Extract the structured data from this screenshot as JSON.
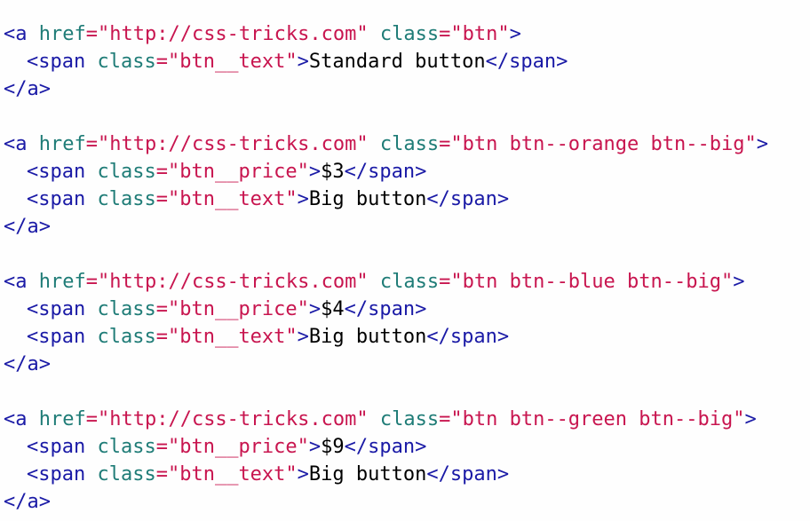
{
  "editor": {
    "blocks": [
      {
        "open_tag_start": "<a",
        "href_attr": "href",
        "href_eq": "=",
        "href_value": "\"http://css-tricks.com\"",
        "class_attr": "class",
        "class_eq": "=",
        "class_value": "\"btn\"",
        "open_tag_end": ">",
        "lines": [
          {
            "span_open": "<span",
            "class_attr": "class",
            "class_eq": "=",
            "class_value": "\"btn__text\"",
            "span_open_end": ">",
            "text": "Standard button",
            "span_close": "</span>"
          }
        ],
        "close_tag": "</a>"
      },
      {
        "open_tag_start": "<a",
        "href_attr": "href",
        "href_eq": "=",
        "href_value": "\"http://css-tricks.com\"",
        "class_attr": "class",
        "class_eq": "=",
        "class_value": "\"btn btn--orange btn--big\"",
        "open_tag_end": ">",
        "lines": [
          {
            "span_open": "<span",
            "class_attr": "class",
            "class_eq": "=",
            "class_value": "\"btn__price\"",
            "span_open_end": ">",
            "text": "$3",
            "span_close": "</span>"
          },
          {
            "span_open": "<span",
            "class_attr": "class",
            "class_eq": "=",
            "class_value": "\"btn__text\"",
            "span_open_end": ">",
            "text": "Big button",
            "span_close": "</span>"
          }
        ],
        "close_tag": "</a>"
      },
      {
        "open_tag_start": "<a",
        "href_attr": "href",
        "href_eq": "=",
        "href_value": "\"http://css-tricks.com\"",
        "class_attr": "class",
        "class_eq": "=",
        "class_value": "\"btn btn--blue btn--big\"",
        "open_tag_end": ">",
        "lines": [
          {
            "span_open": "<span",
            "class_attr": "class",
            "class_eq": "=",
            "class_value": "\"btn__price\"",
            "span_open_end": ">",
            "text": "$4",
            "span_close": "</span>"
          },
          {
            "span_open": "<span",
            "class_attr": "class",
            "class_eq": "=",
            "class_value": "\"btn__text\"",
            "span_open_end": ">",
            "text": "Big button",
            "span_close": "</span>"
          }
        ],
        "close_tag": "</a>"
      },
      {
        "open_tag_start": "<a",
        "href_attr": "href",
        "href_eq": "=",
        "href_value": "\"http://css-tricks.com\"",
        "class_attr": "class",
        "class_eq": "=",
        "class_value": "\"btn btn--green btn--big\"",
        "open_tag_end": ">",
        "lines": [
          {
            "span_open": "<span",
            "class_attr": "class",
            "class_eq": "=",
            "class_value": "\"btn__price\"",
            "span_open_end": ">",
            "text": "$9",
            "span_close": "</span>"
          },
          {
            "span_open": "<span",
            "class_attr": "class",
            "class_eq": "=",
            "class_value": "\"btn__text\"",
            "span_open_end": ">",
            "text": "Big button",
            "span_close": "</span>"
          }
        ],
        "close_tag": "</a>"
      }
    ]
  },
  "colors": {
    "tag": "#1a1aa6",
    "attribute": "#1f7c77",
    "string": "#c8154f",
    "text": "#000000",
    "background": "#fefefe"
  }
}
